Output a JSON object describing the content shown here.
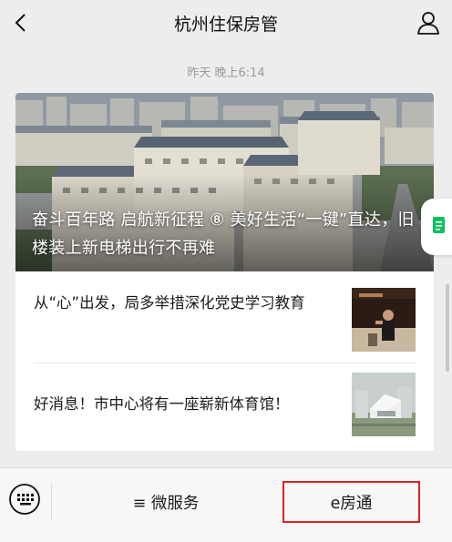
{
  "header": {
    "title": "杭州住保房管"
  },
  "message": {
    "timestamp": "昨天 晚上6:14",
    "featured": {
      "title": "奋斗百年路 启航新征程 ⑧ 美好生活“一键”直达，旧楼装上新电梯出行不再难"
    },
    "articles": [
      {
        "title": "从“心”出发，局多举措深化党史学习教育"
      },
      {
        "title": "好消息！市中心将有一座崭新体育馆！"
      }
    ]
  },
  "bottom_menu": {
    "items": [
      {
        "label": "≡ 微服务"
      },
      {
        "label": "e房通"
      }
    ]
  },
  "colors": {
    "background": "#ededed",
    "selected_outline": "#e02020",
    "wechat_green": "#07c160"
  }
}
